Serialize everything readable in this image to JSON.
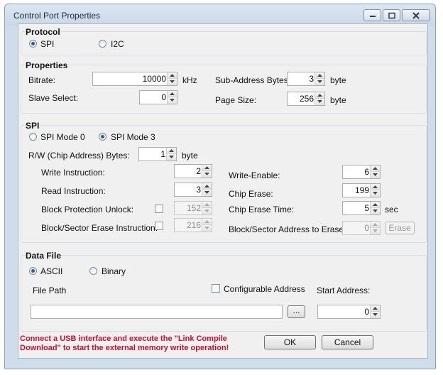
{
  "window": {
    "title": "Control Port Properties"
  },
  "protocol": {
    "title": "Protocol",
    "options": [
      {
        "label": "SPI",
        "selected": true
      },
      {
        "label": "I2C",
        "selected": false
      }
    ]
  },
  "properties": {
    "title": "Properties",
    "bitrate": {
      "label": "Bitrate:",
      "value": "10000",
      "unit": "kHz"
    },
    "slave_select": {
      "label": "Slave Select:",
      "value": "0"
    },
    "sub_address_bytes": {
      "label": "Sub-Address Bytes:",
      "value": "3",
      "unit": "byte"
    },
    "page_size": {
      "label": "Page Size:",
      "value": "256",
      "unit": "byte"
    }
  },
  "spi": {
    "title": "SPI",
    "modes": [
      {
        "label": "SPI Mode 0",
        "selected": false
      },
      {
        "label": "SPI Mode 3",
        "selected": true
      }
    ],
    "rw_bytes": {
      "label": "R/W (Chip Address) Bytes:",
      "value": "1",
      "unit": "byte"
    },
    "write_instruction": {
      "label": "Write Instruction:",
      "value": "2"
    },
    "read_instruction": {
      "label": "Read Instruction:",
      "value": "3"
    },
    "block_protection_unlock": {
      "label": "Block Protection Unlock:",
      "value": "152",
      "checked": false
    },
    "block_sector_erase_instruction": {
      "label": "Block/Sector Erase Instruction:",
      "value": "216",
      "checked": false
    },
    "write_enable": {
      "label": "Write-Enable:",
      "value": "6"
    },
    "chip_erase": {
      "label": "Chip Erase:",
      "value": "199"
    },
    "chip_erase_time": {
      "label": "Chip Erase Time:",
      "value": "5",
      "unit": "sec"
    },
    "block_sector_address": {
      "label": "Block/Sector Address to Erase:",
      "value": "0",
      "button": "Erase"
    }
  },
  "data_file": {
    "title": "Data File",
    "formats": [
      {
        "label": "ASCII",
        "selected": true
      },
      {
        "label": "Binary",
        "selected": false
      }
    ],
    "file_path_label": "File Path",
    "file_path_value": "",
    "browse_label": "...",
    "configurable_address": {
      "label": "Configurable Address",
      "checked": false
    },
    "start_address": {
      "label": "Start Address:",
      "value": "0"
    }
  },
  "footer": {
    "warning": "Connect a USB interface and execute the \"Link Compile Download\" to start the external memory write operation!",
    "ok_label": "OK",
    "cancel_label": "Cancel"
  },
  "colors": {
    "warning": "#c8102e",
    "radio_selected": "#2a5aa8"
  }
}
